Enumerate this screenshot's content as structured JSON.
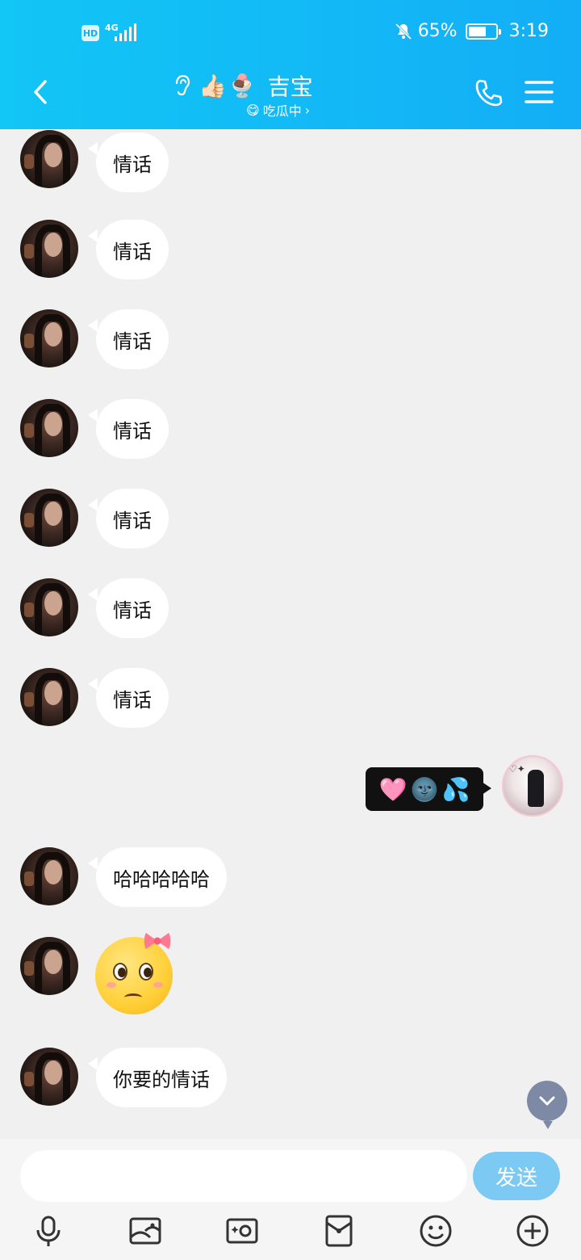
{
  "status_bar": {
    "hd": "HD",
    "network": "4G",
    "battery_percent": "65%",
    "battery_level": 0.65,
    "time": "3:19"
  },
  "header": {
    "contact_name": "吉宝",
    "status_text": "吃瓜中",
    "icons": [
      "back-icon",
      "ear-icon",
      "thumbs-up-emoji",
      "sundae-emoji",
      "phone-icon",
      "menu-icon"
    ]
  },
  "messages": [
    {
      "from": "other",
      "type": "text",
      "text": "情话"
    },
    {
      "from": "other",
      "type": "text",
      "text": "情话"
    },
    {
      "from": "other",
      "type": "text",
      "text": "情话"
    },
    {
      "from": "other",
      "type": "text",
      "text": "情话"
    },
    {
      "from": "other",
      "type": "text",
      "text": "情话"
    },
    {
      "from": "other",
      "type": "text",
      "text": "情话"
    },
    {
      "from": "other",
      "type": "text",
      "text": "情话"
    },
    {
      "from": "me",
      "type": "emoji",
      "emojis": [
        "🩷",
        "🌚",
        "💦"
      ]
    },
    {
      "from": "other",
      "type": "text",
      "text": "哈哈哈哈哈"
    },
    {
      "from": "other",
      "type": "sticker",
      "sticker": "pleading-face-with-bow"
    },
    {
      "from": "other",
      "type": "text",
      "text": "你要的情话"
    }
  ],
  "input": {
    "value": "",
    "placeholder": "",
    "send_label": "发送"
  },
  "toolbar": [
    "microphone-icon",
    "image-icon",
    "camera-icon",
    "red-packet-icon",
    "emoji-icon",
    "plus-icon"
  ],
  "colors": {
    "header_start": "#12c6f6",
    "header_end": "#13aef6",
    "send_button": "#7cc9f3",
    "chat_background": "#f0f0f0",
    "sent_bubble": "#111111"
  }
}
